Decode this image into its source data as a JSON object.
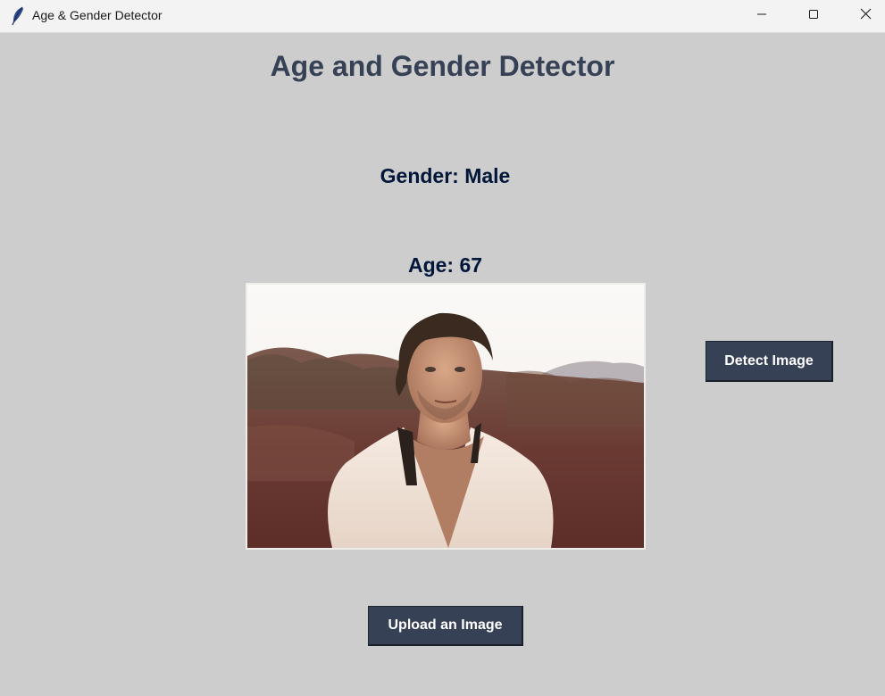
{
  "window": {
    "title": "Age & Gender Detector",
    "controls": [
      "minimize",
      "maximize",
      "close"
    ]
  },
  "main": {
    "heading": "Age and Gender Detector",
    "gender_text": "Gender: Male",
    "age_text": "Age: 67",
    "detect_button": "Detect Image",
    "upload_button": "Upload an Image",
    "image": "uploaded portrait photo of a man in a white shirt, desert background"
  },
  "colors": {
    "background": "#cdcdcd",
    "heading": "#364156",
    "result_text": "#011638",
    "button_bg": "#364156",
    "button_text": "#ffffff"
  },
  "icons": {
    "app": "feather-icon",
    "minimize": "minimize-icon",
    "maximize": "maximize-icon",
    "close": "close-icon"
  }
}
